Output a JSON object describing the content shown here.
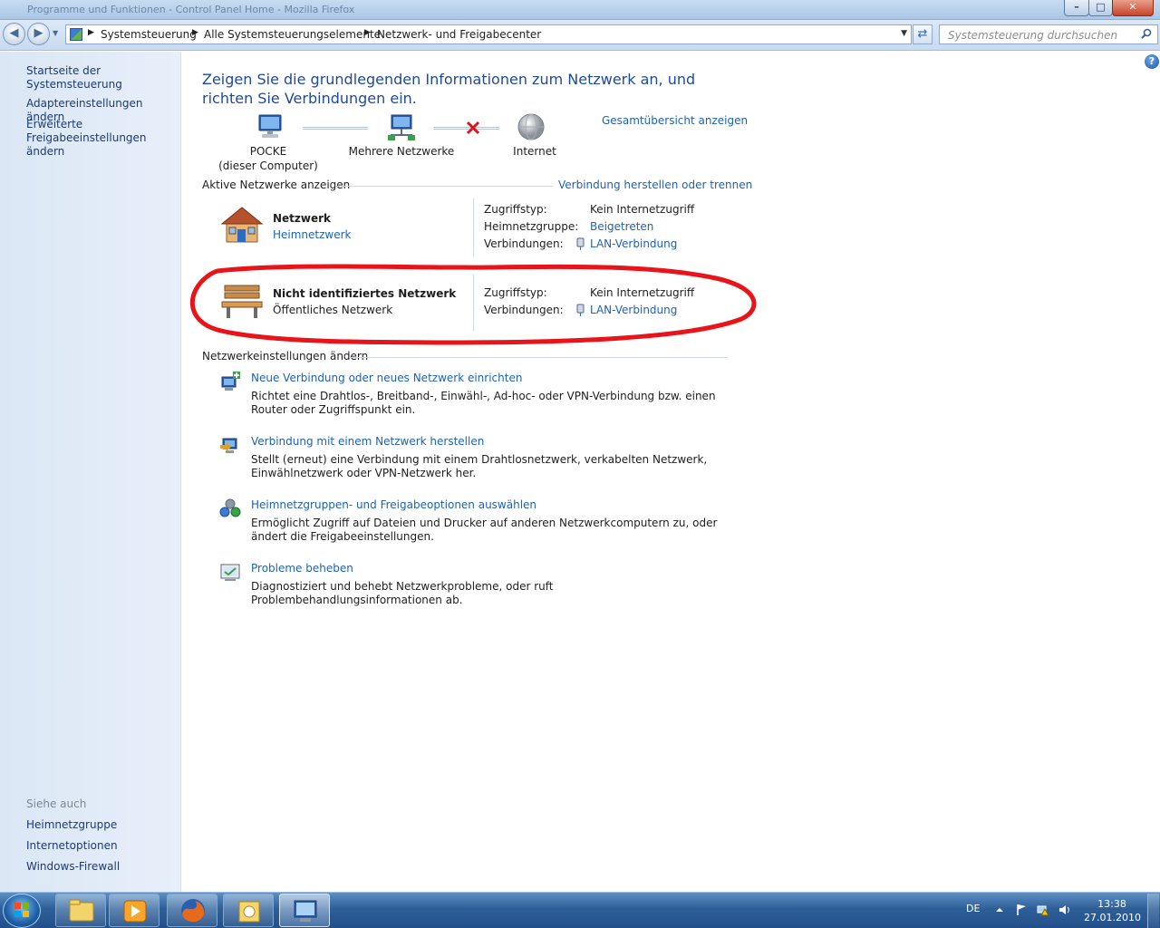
{
  "window": {
    "title": "Programme und Funktionen - Control Panel Home - Mozilla Firefox",
    "minimize_symbol": "–",
    "maximize_symbol": "□",
    "close_symbol": "✕"
  },
  "addressbar": {
    "crumbs": [
      "Systemsteuerung",
      "Alle Systemsteuerungselemente",
      "Netzwerk- und Freigabecenter"
    ],
    "search_placeholder": "Systemsteuerung durchsuchen"
  },
  "sidebar": {
    "links": [
      "Startseite der Systemsteuerung",
      "Adaptereinstellungen ändern",
      "Erweiterte Freigabeeinstellungen ändern"
    ],
    "see_also_title": "Siehe auch",
    "see_also": [
      "Heimnetzgruppe",
      "Internetoptionen",
      "Windows-Firewall"
    ]
  },
  "main": {
    "title": "Zeigen Sie die grundlegenden Informationen zum Netzwerk an, und richten Sie Verbindungen ein.",
    "full_map_link": "Gesamtübersicht anzeigen",
    "map": {
      "computer_name": "POCKE",
      "computer_sub": "(dieser Computer)",
      "middle": "Mehrere Netzwerke",
      "internet": "Internet"
    },
    "active_networks": {
      "heading": "Aktive Netzwerke anzeigen",
      "connect_link": "Verbindung herstellen oder trennen",
      "networks": [
        {
          "name": "Netzwerk",
          "type": "Heimnetzwerk",
          "access_label": "Zugriffstyp:",
          "access_value": "Kein Internetzugriff",
          "homegroup_label": "Heimnetzgruppe:",
          "homegroup_value": "Beigetreten",
          "connections_label": "Verbindungen:",
          "connections_value": "LAN-Verbindung"
        },
        {
          "name": "Nicht identifiziertes Netzwerk",
          "type": "Öffentliches Netzwerk",
          "access_label": "Zugriffstyp:",
          "access_value": "Kein Internetzugriff",
          "connections_label": "Verbindungen:",
          "connections_value": "LAN-Verbindung"
        }
      ]
    },
    "settings": {
      "heading": "Netzwerkeinstellungen ändern",
      "tasks": [
        {
          "link": "Neue Verbindung oder neues Netzwerk einrichten",
          "desc": "Richtet eine Drahtlos-, Breitband-, Einwähl-, Ad-hoc- oder VPN-Verbindung bzw. einen Router oder Zugriffspunkt ein."
        },
        {
          "link": "Verbindung mit einem Netzwerk herstellen",
          "desc": "Stellt (erneut) eine Verbindung mit einem Drahtlosnetzwerk, verkabelten Netzwerk, Einwählnetzwerk oder VPN-Netzwerk her."
        },
        {
          "link": "Heimnetzgruppen- und Freigabeoptionen auswählen",
          "desc": "Ermöglicht Zugriff auf Dateien und Drucker auf anderen Netzwerkcomputern zu, oder ändert die Freigabeeinstellungen."
        },
        {
          "link": "Probleme beheben",
          "desc": "Diagnostiziert und behebt Netzwerkprobleme, oder ruft Problembehandlungsinformationen ab."
        }
      ]
    }
  },
  "taskbar": {
    "language": "DE",
    "time": "13:38",
    "date": "27.01.2010"
  },
  "colors": {
    "link": "#1e62b0",
    "title": "#1e4a9c",
    "annotation": "#e8141a"
  }
}
